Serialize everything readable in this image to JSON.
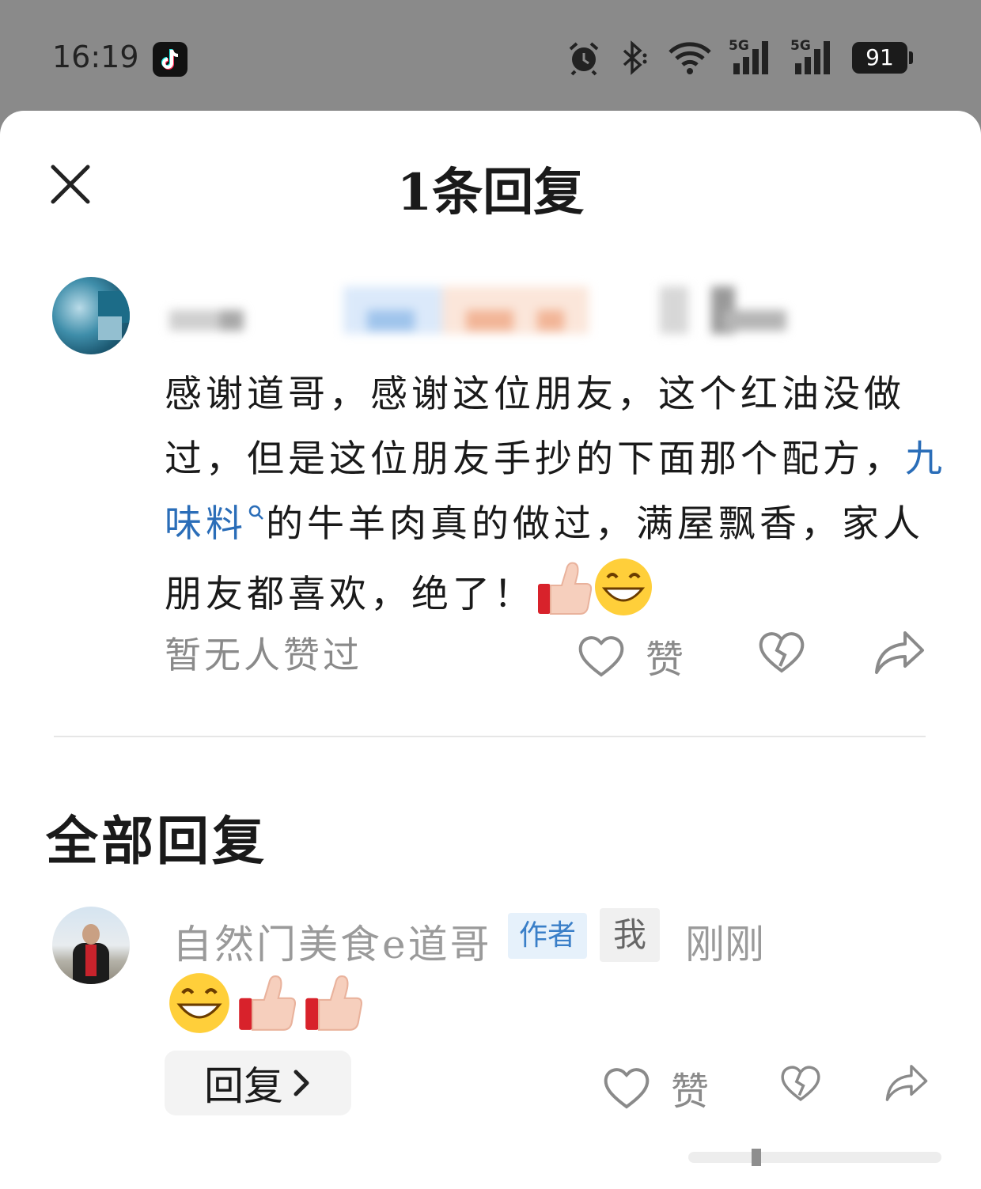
{
  "status_bar": {
    "time": "16:19",
    "net1": "5G",
    "net2": "5G",
    "battery": "91",
    "icons": [
      "tiktok-icon",
      "alarm-icon",
      "bluetooth-icon",
      "wifi-icon",
      "signal-icon",
      "signal-icon",
      "battery-icon"
    ]
  },
  "sheet": {
    "title": "1条回复",
    "close_icon": "close-icon"
  },
  "comment": {
    "text_before": "感谢道哥，感谢这位朋友，这个红油没做过，但是这位朋友手抄的下面那个配方，",
    "link_text": "九味料",
    "text_after": "的牛羊肉真的做过，满屋飘香，家人朋友都喜欢，绝了！",
    "emojis": [
      "thumbs-up",
      "grin"
    ],
    "likes_text": "暂无人赞过",
    "like_label": "赞",
    "icons": [
      "heart-icon",
      "broken-heart-icon",
      "share-icon"
    ]
  },
  "all_replies": {
    "title": "全部回复",
    "items": [
      {
        "name": "自然门美食e道哥",
        "tag_author": "作者",
        "tag_me": "我",
        "time": "刚刚",
        "emojis": [
          "grin",
          "thumbs-up",
          "thumbs-up"
        ],
        "reply_button": "回复",
        "like_label": "赞"
      }
    ]
  },
  "colors": {
    "link": "#2a6db8",
    "muted": "#8a8a8a",
    "author_tag_bg": "#e6f1fb",
    "author_tag_text": "#3a7fc8"
  }
}
